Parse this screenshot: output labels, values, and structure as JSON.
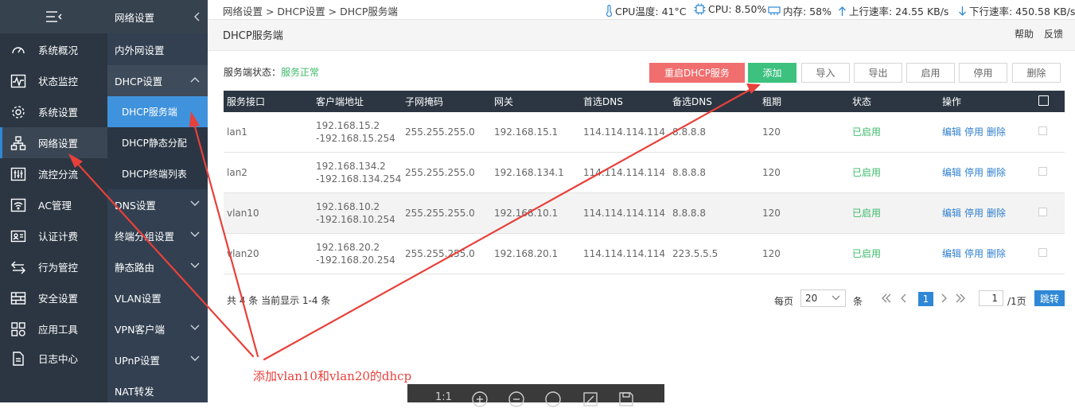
{
  "sidebar": {
    "items": [
      {
        "label": "系统概况",
        "icon": "dashboard-icon"
      },
      {
        "label": "状态监控",
        "icon": "pulse-icon"
      },
      {
        "label": "系统设置",
        "icon": "gear-icon"
      },
      {
        "label": "网络设置",
        "icon": "network-icon"
      },
      {
        "label": "流控分流",
        "icon": "sliders-icon"
      },
      {
        "label": "AC管理",
        "icon": "wifi-icon"
      },
      {
        "label": "认证计费",
        "icon": "id-card-icon"
      },
      {
        "label": "行为管控",
        "icon": "swap-arrows-icon"
      },
      {
        "label": "安全设置",
        "icon": "firewall-icon"
      },
      {
        "label": "应用工具",
        "icon": "apps-icon"
      },
      {
        "label": "日志中心",
        "icon": "log-icon"
      }
    ]
  },
  "subnav": {
    "title": "网络设置",
    "lan": "内外网设置",
    "dhcp": "DHCP设置",
    "dhcp_server": "DHCP服务端",
    "dhcp_static": "DHCP静态分配",
    "dhcp_clients": "DHCP终端列表",
    "dns": "DNS设置",
    "terminal_group": "终端分组设置",
    "static_route": "静态路由",
    "vlan": "VLAN设置",
    "vpn": "VPN客户端",
    "upnp": "UPnP设置",
    "nat": "NAT转发"
  },
  "topbar": {
    "breadcrumb": "网络设置 > DHCP设置 > DHCP服务端",
    "cpu_temp": "CPU温度: 41°C",
    "cpu_usage": "CPU: 8.50%",
    "memory": "内存: 58%",
    "upload": "上行速率: 24.55 KB/s",
    "download": "下行速率: 450.58 KB/s"
  },
  "page": {
    "title": "DHCP服务端",
    "help": "帮助",
    "feedback": "反馈",
    "status_label": "服务端状态：",
    "status_value": "服务正常"
  },
  "toolbar": {
    "restart": "重启DHCP服务",
    "add": "添加",
    "import": "导入",
    "export": "导出",
    "enable": "启用",
    "disable": "停用",
    "delete": "删除"
  },
  "table": {
    "headers": [
      "服务接口",
      "客户端地址",
      "子网掩码",
      "网关",
      "首选DNS",
      "备选DNS",
      "租期",
      "状态",
      "操作"
    ],
    "rows": [
      {
        "iface": "lan1",
        "range_start": "192.168.15.2",
        "range_end": "-192.168.15.254",
        "mask": "255.255.255.0",
        "gateway": "192.168.15.1",
        "dns1": "114.114.114.114",
        "dns2": "8.8.8.8",
        "lease": "120",
        "status": "已启用"
      },
      {
        "iface": "lan2",
        "range_start": "192.168.134.2",
        "range_end": "-192.168.134.254",
        "mask": "255.255.255.0",
        "gateway": "192.168.134.1",
        "dns1": "114.114.114.114",
        "dns2": "8.8.8.8",
        "lease": "120",
        "status": "已启用"
      },
      {
        "iface": "vlan10",
        "range_start": "192.168.10.2",
        "range_end": "-192.168.10.254",
        "mask": "255.255.255.0",
        "gateway": "192.168.10.1",
        "dns1": "114.114.114.114",
        "dns2": "8.8.8.8",
        "lease": "120",
        "status": "已启用"
      },
      {
        "iface": "vlan20",
        "range_start": "192.168.20.2",
        "range_end": "-192.168.20.254",
        "mask": "255.255.255.0",
        "gateway": "192.168.20.1",
        "dns1": "114.114.114.114",
        "dns2": "223.5.5.5",
        "lease": "120",
        "status": "已启用"
      }
    ],
    "actions": {
      "edit": "编辑",
      "disable": "停用",
      "delete": "删除"
    }
  },
  "pager": {
    "summary": "共 4 条 当前显示 1-4 条",
    "per_page_label": "每页",
    "per_page_value": "20",
    "unit": "条",
    "current_page": "1",
    "page_input": "1",
    "total_pages": "/1页",
    "jump": "跳转"
  },
  "annotation": {
    "text": "添加vlan10和vlan20的dhcp",
    "color": "#e8403a"
  },
  "viewer": {
    "zoom": "1:1"
  }
}
